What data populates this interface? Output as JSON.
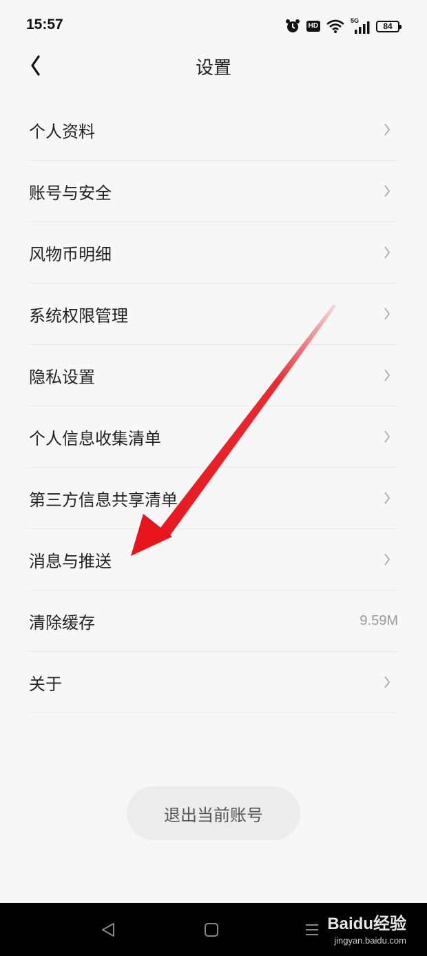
{
  "status_bar": {
    "time": "15:57",
    "hd_label": "HD",
    "network_label": "5G",
    "battery_level": "84"
  },
  "header": {
    "title": "设置"
  },
  "settings": {
    "items": [
      {
        "label": "个人资料",
        "value": null
      },
      {
        "label": "账号与安全",
        "value": null
      },
      {
        "label": "风物币明细",
        "value": null
      },
      {
        "label": "系统权限管理",
        "value": null
      },
      {
        "label": "隐私设置",
        "value": null
      },
      {
        "label": "个人信息收集清单",
        "value": null
      },
      {
        "label": "第三方信息共享清单",
        "value": null
      },
      {
        "label": "消息与推送",
        "value": null
      },
      {
        "label": "清除缓存",
        "value": "9.59M"
      },
      {
        "label": "关于",
        "value": null
      }
    ]
  },
  "logout_button_label": "退出当前账号",
  "watermark": {
    "logo": "Baidu经验",
    "url": "jingyan.baidu.com"
  },
  "colors": {
    "background": "#f7f7f7",
    "annotation_arrow": "#e8141b",
    "nav_bar": "#000000"
  }
}
